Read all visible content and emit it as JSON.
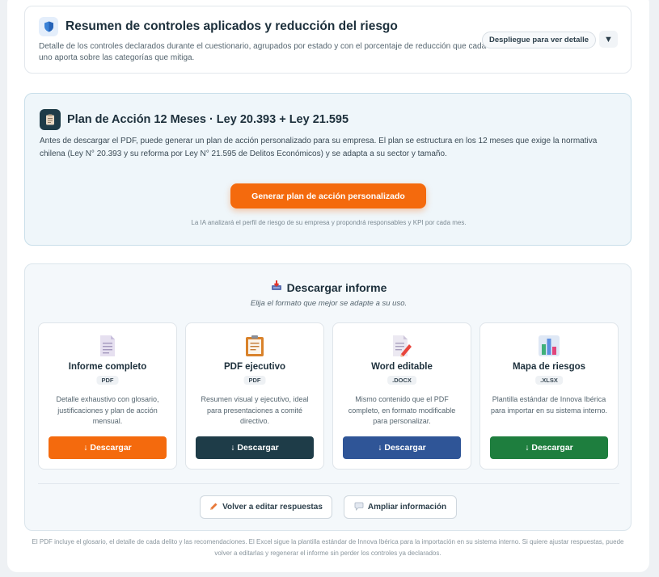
{
  "summary": {
    "title": "Resumen de controles aplicados y reducción del riesgo",
    "description": "Detalle de los controles declarados durante el cuestionario, agrupados por estado y con el porcentaje de reducción que cada uno aporta sobre las categorías que mitiga.",
    "expand_label": "Despliegue para ver detalle",
    "chevron": "▼",
    "icon": "shield-icon"
  },
  "plan": {
    "title": "Plan de Acción 12 Meses · Ley 20.393 + Ley 21.595",
    "description": "Antes de descargar el PDF, puede generar un plan de acción personalizado para su empresa. El plan se estructura en los 12 meses que exige la normativa chilena (Ley N° 20.393 y su reforma por Ley N° 21.595 de Delitos Económicos) y se adapta a su sector y tamaño.",
    "button_label": "Generar plan de acción personalizado",
    "note": "La IA analizará el perfil de riesgo de su empresa y propondrá responsables y KPI por cada mes.",
    "icon": "clipboard-icon",
    "accent": "#f46a0d"
  },
  "download": {
    "title": "Descargar informe",
    "subtitle": "Elija el formato que mejor se adapte a su uso.",
    "icon": "inbox-tray-icon",
    "formats": [
      {
        "name": "Informe completo",
        "tag": "PDF",
        "desc": "Detalle exhaustivo con glosario, justificaciones y plan de acción mensual.",
        "button": "↓ Descargar",
        "color": "#f46a0d",
        "icon": "document-icon"
      },
      {
        "name": "PDF ejecutivo",
        "tag": "PDF",
        "desc": "Resumen visual y ejecutivo, ideal para presentaciones a comité directivo.",
        "button": "↓ Descargar",
        "color": "#1e3c48",
        "icon": "clipboard-icon"
      },
      {
        "name": "Word editable",
        "tag": ".DOCX",
        "desc": "Mismo contenido que el PDF completo, en formato modificable para personalizar.",
        "button": "↓ Descargar",
        "color": "#2f5597",
        "icon": "memo-icon"
      },
      {
        "name": "Mapa de riesgos",
        "tag": ".XLSX",
        "desc": "Plantilla estándar de Innova Ibérica para importar en su sistema interno.",
        "button": "↓ Descargar",
        "color": "#1e7e3e",
        "icon": "bar-chart-icon"
      }
    ],
    "edit_label": "Volver a editar respuestas",
    "more_label": "Ampliar información"
  },
  "footer": {
    "note": "El PDF incluye el glosario, el detalle de cada delito y las recomendaciones. El Excel sigue la plantilla estándar de Innova Ibérica para la importación en su sistema interno. Si quiere ajustar respuestas, puede volver a editarlas y regenerar el informe sin perder los controles ya declarados."
  }
}
